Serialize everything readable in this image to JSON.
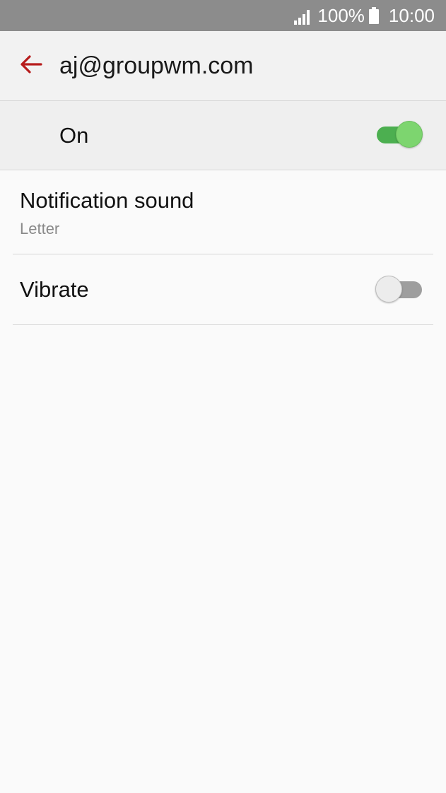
{
  "status_bar": {
    "battery": "100%",
    "time": "10:00",
    "signal_icon": "signal-icon",
    "battery_icon": "battery-icon"
  },
  "header": {
    "title": "aj@groupwm.com",
    "back_icon": "back-arrow-icon"
  },
  "master_switch": {
    "label": "On",
    "checked": true
  },
  "settings": {
    "notification_sound": {
      "title": "Notification sound",
      "value": "Letter"
    },
    "vibrate": {
      "title": "Vibrate",
      "checked": false
    }
  },
  "colors": {
    "accent": "#b71c1c",
    "toggle_on": "#4caf50",
    "toggle_off": "#9e9e9e",
    "status_bar": "#8c8c8c"
  }
}
